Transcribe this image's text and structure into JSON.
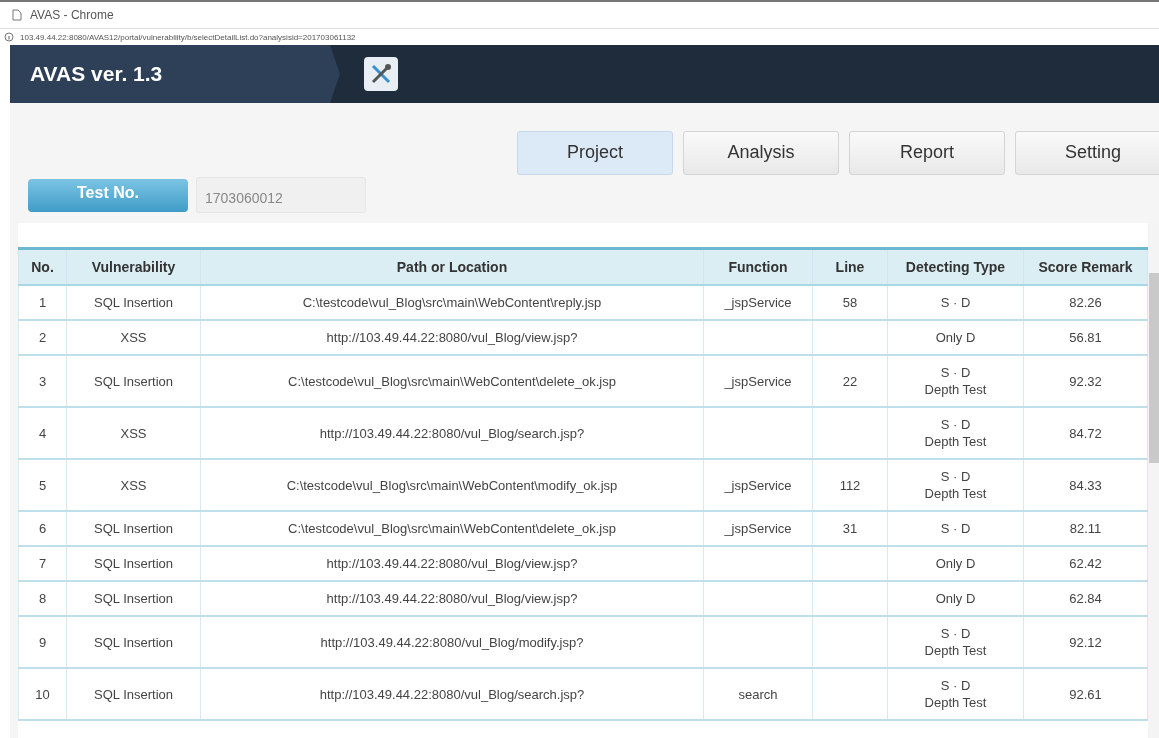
{
  "browser": {
    "title": "AVAS - Chrome",
    "url": "103.49.44.22:8080/AVAS12/portal/vulnerability/b/selectDetailList.do?analysisid=201703061132"
  },
  "header": {
    "title": "AVAS ver. 1.3"
  },
  "tabs": [
    {
      "label": "Project",
      "selected": true
    },
    {
      "label": "Analysis",
      "selected": false
    },
    {
      "label": "Report",
      "selected": false
    },
    {
      "label": "Setting",
      "selected": false
    }
  ],
  "test": {
    "button": "Test No.",
    "value": "1703060012"
  },
  "table": {
    "columns": [
      "No.",
      "Vulnerability",
      "Path or Location",
      "Function",
      "Line",
      "Detecting Type",
      "Score Remark"
    ],
    "rows": [
      {
        "no": "1",
        "vulnerability": "SQL Insertion",
        "path": "C:\\testcode\\vul_Blog\\src\\main\\WebContent\\reply.jsp",
        "function": "_jspService",
        "line": "58",
        "detecting": [
          "S · D"
        ],
        "score": "82.26"
      },
      {
        "no": "2",
        "vulnerability": "XSS",
        "path": "http://103.49.44.22:8080/vul_Blog/view.jsp?",
        "detecting": [
          "Only D"
        ],
        "score": "56.81"
      },
      {
        "no": "3",
        "vulnerability": "SQL Insertion",
        "path": "C:\\testcode\\vul_Blog\\src\\main\\WebContent\\delete_ok.jsp",
        "function": "_jspService",
        "line": "22",
        "detecting": [
          "S · D",
          "Depth Test"
        ],
        "score": "92.32"
      },
      {
        "no": "4",
        "vulnerability": "XSS",
        "path": "http://103.49.44.22:8080/vul_Blog/search.jsp?",
        "detecting": [
          "S · D",
          "Depth Test"
        ],
        "score": "84.72"
      },
      {
        "no": "5",
        "vulnerability": "XSS",
        "path": "C:\\testcode\\vul_Blog\\src\\main\\WebContent\\modify_ok.jsp",
        "function": "_jspService",
        "line": "112",
        "detecting": [
          "S · D",
          "Depth Test"
        ],
        "score": "84.33"
      },
      {
        "no": "6",
        "vulnerability": "SQL Insertion",
        "path": "C:\\testcode\\vul_Blog\\src\\main\\WebContent\\delete_ok.jsp",
        "function": "_jspService",
        "line": "31",
        "detecting": [
          "S · D"
        ],
        "score": "82.11"
      },
      {
        "no": "7",
        "vulnerability": "SQL Insertion",
        "path": "http://103.49.44.22:8080/vul_Blog/view.jsp?",
        "detecting": [
          "Only D"
        ],
        "score": "62.42"
      },
      {
        "no": "8",
        "vulnerability": "SQL Insertion",
        "path": "http://103.49.44.22:8080/vul_Blog/view.jsp?",
        "detecting": [
          "Only D"
        ],
        "score": "62.84"
      },
      {
        "no": "9",
        "vulnerability": "SQL Insertion",
        "path": "http://103.49.44.22:8080/vul_Blog/modify.jsp?",
        "detecting": [
          "S · D",
          "Depth Test"
        ],
        "score": "92.12"
      },
      {
        "no": "10",
        "vulnerability": "SQL Insertion",
        "path": "http://103.49.44.22:8080/vul_Blog/search.jsp?",
        "function": "search",
        "detecting": [
          "S · D",
          "Depth Test"
        ],
        "score": "92.61"
      }
    ]
  }
}
